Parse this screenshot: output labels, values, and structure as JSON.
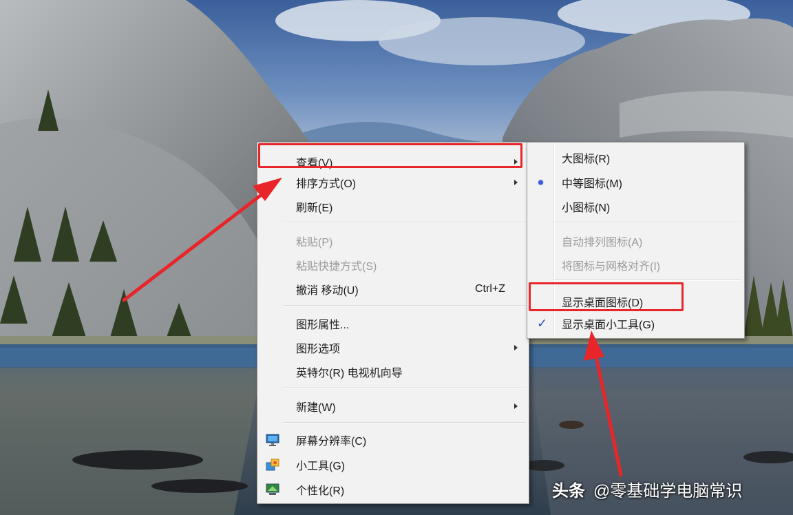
{
  "main_menu": {
    "items": [
      {
        "label": "查看(V)",
        "submenu": true
      },
      {
        "label": "排序方式(O)",
        "submenu": true
      },
      {
        "label": "刷新(E)"
      },
      {
        "label": "粘贴(P)",
        "disabled": true
      },
      {
        "label": "粘贴快捷方式(S)",
        "disabled": true
      },
      {
        "label": "撤消 移动(U)",
        "shortcut": "Ctrl+Z"
      },
      {
        "label": "图形属性..."
      },
      {
        "label": "图形选项",
        "submenu": true
      },
      {
        "label": "英特尔(R) 电视机向导"
      },
      {
        "label": "新建(W)",
        "submenu": true
      },
      {
        "label": "屏幕分辨率(C)",
        "icon": "monitor-icon"
      },
      {
        "label": "小工具(G)",
        "icon": "gadgets-icon"
      },
      {
        "label": "个性化(R)",
        "icon": "personalize-icon"
      }
    ]
  },
  "view_submenu": {
    "items": [
      {
        "label": "大图标(R)"
      },
      {
        "label": "中等图标(M)",
        "selected": true
      },
      {
        "label": "小图标(N)"
      },
      {
        "label": "自动排列图标(A)",
        "disabled": true
      },
      {
        "label": "将图标与网格对齐(I)",
        "disabled": true
      },
      {
        "label": "显示桌面图标(D)"
      },
      {
        "label": "显示桌面小工具(G)",
        "checked": true
      }
    ]
  },
  "annotation": {
    "color": "#e8262a"
  },
  "watermark": {
    "brand": "头条",
    "account": "@零基础学电脑常识"
  }
}
